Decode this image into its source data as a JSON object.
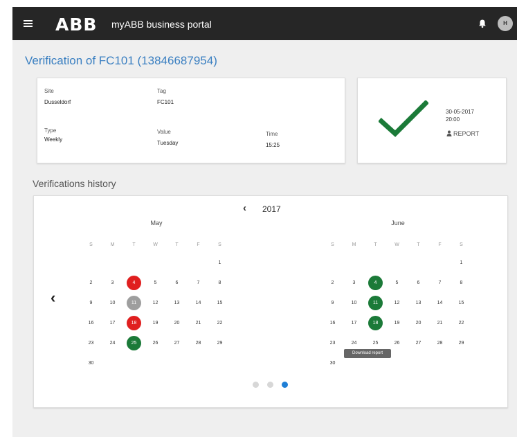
{
  "header": {
    "logo": "ABB",
    "title": "myABB business portal",
    "avatar_initials": "H"
  },
  "page": {
    "title": "Verification of  FC101 (13846687954)"
  },
  "details": {
    "site_label": "Site",
    "site_value": "Dusseldorf",
    "tag_label": "Tag",
    "tag_value": "FC101",
    "type_label": "Type",
    "type_value": "Weekly",
    "value_label": "Value",
    "value_value": "Tuesday",
    "time_label": "Time",
    "time_value": "15:25"
  },
  "status": {
    "timestamp_line1": "30-05-2017",
    "timestamp_line2": "20:00",
    "report_label": "REPORT",
    "check_color": "#1b7a38"
  },
  "history": {
    "title": "Verifications history",
    "year": "2017",
    "weekday_headers": [
      "S",
      "M",
      "T",
      "W",
      "T",
      "F",
      "S"
    ],
    "months": [
      {
        "name": "May",
        "leading_blanks": 6,
        "days": [
          {
            "d": "1"
          },
          {
            "d": "2"
          },
          {
            "d": "3"
          },
          {
            "d": "4",
            "status": "red"
          },
          {
            "d": "5"
          },
          {
            "d": "6"
          },
          {
            "d": "7"
          },
          {
            "d": "8"
          },
          {
            "d": "9"
          },
          {
            "d": "10"
          },
          {
            "d": "11",
            "status": "grey"
          },
          {
            "d": "12"
          },
          {
            "d": "13"
          },
          {
            "d": "14"
          },
          {
            "d": "15"
          },
          {
            "d": "16"
          },
          {
            "d": "17"
          },
          {
            "d": "18",
            "status": "red"
          },
          {
            "d": "19"
          },
          {
            "d": "20"
          },
          {
            "d": "21"
          },
          {
            "d": "22"
          },
          {
            "d": "23"
          },
          {
            "d": "24"
          },
          {
            "d": "25",
            "status": "green"
          },
          {
            "d": "26"
          },
          {
            "d": "27"
          },
          {
            "d": "28"
          },
          {
            "d": "29"
          },
          {
            "d": "30"
          }
        ]
      },
      {
        "name": "June",
        "leading_blanks": 6,
        "days": [
          {
            "d": "1"
          },
          {
            "d": "2"
          },
          {
            "d": "3"
          },
          {
            "d": "4",
            "status": "green"
          },
          {
            "d": "5"
          },
          {
            "d": "6"
          },
          {
            "d": "7"
          },
          {
            "d": "8"
          },
          {
            "d": "9"
          },
          {
            "d": "10"
          },
          {
            "d": "11",
            "status": "green"
          },
          {
            "d": "12"
          },
          {
            "d": "13"
          },
          {
            "d": "14"
          },
          {
            "d": "15"
          },
          {
            "d": "16"
          },
          {
            "d": "17"
          },
          {
            "d": "18",
            "status": "green"
          },
          {
            "d": "19"
          },
          {
            "d": "20"
          },
          {
            "d": "21"
          },
          {
            "d": "22"
          },
          {
            "d": "23"
          },
          {
            "d": "24"
          },
          {
            "d": "25"
          },
          {
            "d": "26"
          },
          {
            "d": "27"
          },
          {
            "d": "28"
          },
          {
            "d": "29"
          },
          {
            "d": "30"
          }
        ]
      }
    ],
    "tooltip": "Download report",
    "pagination": {
      "count": 3,
      "active": 2
    }
  },
  "colors": {
    "topbar": "#262626",
    "accent": "#3a7fc1",
    "fail": "#e01f1f",
    "pass": "#1b7a38",
    "skipped": "#9e9e9e"
  }
}
